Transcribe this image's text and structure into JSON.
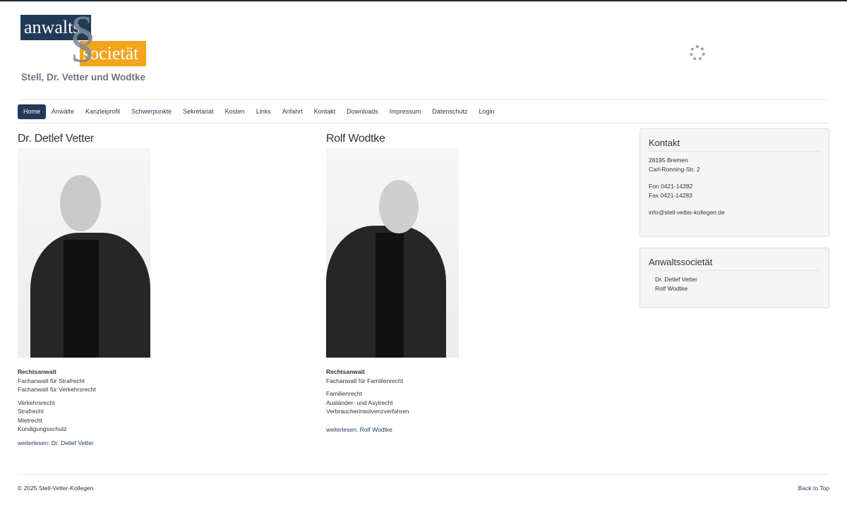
{
  "logo": {
    "word1": "anwalts",
    "word2": "societät",
    "symbol": "§",
    "subtitle": "Stell, Dr. Vetter und Wodtke"
  },
  "nav": [
    "Home",
    "Anwälte",
    "Kanzleiprofil",
    "Schwerpunkte",
    "Sekretariat",
    "Kosten",
    "Links",
    "Anfahrt",
    "Kontakt",
    "Downloads",
    "Impressum",
    "Datenschutz",
    "Login"
  ],
  "lawyers": [
    {
      "name": "Dr. Detlef Vetter",
      "title": "Rechtsanwalt",
      "specialties": [
        "Fachanwalt für Strafrecht",
        "Fachanwalt für Verkehrsrecht"
      ],
      "areas": [
        "Verkehrsrecht",
        "Strafrecht",
        "Mietrecht",
        "Kündigungsschutz"
      ],
      "readmore": "weiterlesen: Dr. Detlef Vetter"
    },
    {
      "name": "Rolf Wodtke",
      "title": "Rechtsanwalt",
      "specialties": [
        "Fachanwalt für Familienrecht"
      ],
      "areas": [
        "Familienrecht",
        "Ausländer- und Asylrecht",
        "Verbraucherinsolvenzverfahren"
      ],
      "readmore": "weiterlesen: Rolf Wodtke"
    }
  ],
  "contact": {
    "heading": "Kontakt",
    "city": "28195 Bremen",
    "street": "Carl-Ronning-Str. 2",
    "phone": "Fon 0421-14282",
    "fax": "Fax 0421-14283",
    "email": "info@stell-vetter-kollegen.de"
  },
  "society": {
    "heading": "Anwaltssocietät",
    "members": [
      "Dr. Detlef Vetter",
      "Rolf Wodtke"
    ]
  },
  "footer": {
    "copyright": "© 2025 Stell-Vetter-Kollegen",
    "back_to_top": "Back to Top"
  },
  "colors": {
    "navy": "#1f3a5a",
    "orange": "#f4a41a"
  }
}
